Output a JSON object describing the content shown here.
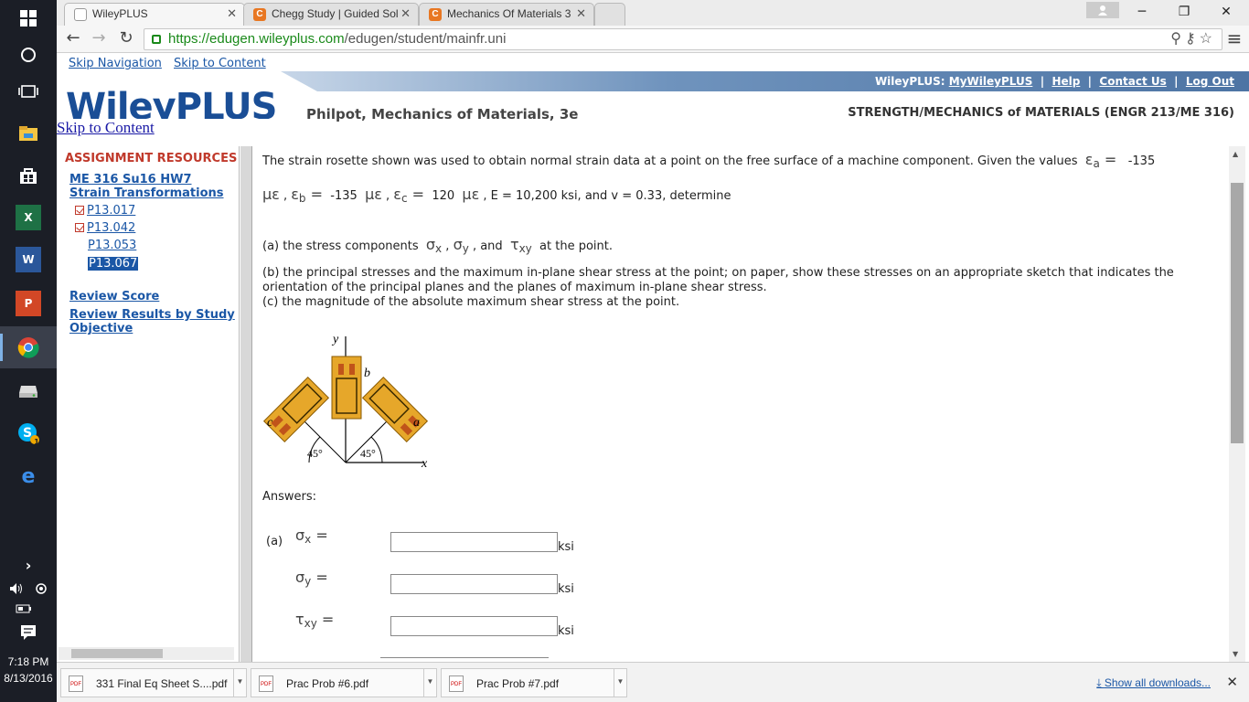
{
  "taskbar": {
    "time": "7:18 PM",
    "date": "8/13/2016",
    "icons": [
      "windows-start",
      "cortana",
      "task-view",
      "file-explorer",
      "store",
      "excel",
      "word",
      "powerpoint",
      "chrome",
      "drive",
      "skype",
      "edge"
    ],
    "skype_badge": "1"
  },
  "browser": {
    "tabs": [
      {
        "title": "WileyPLUS",
        "active": true
      },
      {
        "title": "Chegg Study | Guided Sol",
        "active": false
      },
      {
        "title": "Mechanics Of Materials 3",
        "active": false
      }
    ],
    "url_secure": "https://edugen.wileyplus.com",
    "url_path": "/edugen/student/mainfr.uni"
  },
  "header": {
    "skip_navigation": "Skip Navigation",
    "skip_content": "Skip to Content",
    "wileyplus_label": "WileyPLUS:",
    "links": [
      "MyWileyPLUS",
      "Help",
      "Contact Us",
      "Log Out"
    ],
    "logo": "WileyPLUS",
    "skip_content_2": "Skip to Content",
    "book_title": "Philpot, Mechanics of Materials, 3e",
    "course_title": "STRENGTH/MECHANICS of MATERIALS (ENGR 213/ME 316)"
  },
  "sidebar": {
    "section_title": "ASSIGNMENT RESOURCES",
    "assignment_line1": "ME 316 Su16 HW7",
    "assignment_line2": "Strain Transformations",
    "problems": [
      {
        "label": "P13.017",
        "checked": true,
        "selected": false
      },
      {
        "label": "P13.042",
        "checked": true,
        "selected": false
      },
      {
        "label": "P13.053",
        "checked": false,
        "selected": false
      },
      {
        "label": "P13.067",
        "checked": false,
        "selected": true
      }
    ],
    "review_score": "Review Score",
    "review_results_1": "Review Results by Study",
    "review_results_2": "Objective"
  },
  "problem": {
    "intro": "The strain rosette shown was used to obtain normal strain data at a point on the free surface of a machine component. Given the values",
    "eps_a": "-135",
    "eps_b": "-135",
    "eps_c": "120",
    "unit_strain": "με",
    "E_text": ", E = 10,200 ksi, and",
    "nu_text": "v = 0.33, determine",
    "part_a_prefix": "(a) the stress components",
    "part_a_suffix": "at the point.",
    "part_b": "(b) the principal stresses and the maximum in-plane shear stress at the point; on paper, show these stresses on an appropriate sketch that indicates the orientation of the principal planes and the planes of maximum in-plane shear stress.",
    "part_c": "(c) the magnitude of the absolute maximum shear stress at the point.",
    "figure": {
      "axis_y": "y",
      "axis_x": "x",
      "gauge_a": "a",
      "gauge_b": "b",
      "gauge_c": "c",
      "angle_left": "45°",
      "angle_right": "45°"
    },
    "answers_label": "Answers:",
    "answers": [
      {
        "part": "(a)",
        "symbol": "σ",
        "sub": "x",
        "unit": "ksi",
        "value": ""
      },
      {
        "part": "",
        "symbol": "σ",
        "sub": "y",
        "unit": "ksi",
        "value": ""
      },
      {
        "part": "",
        "symbol": "τ",
        "sub": "xy",
        "unit": "ksi",
        "value": ""
      }
    ]
  },
  "downloads": {
    "items": [
      "331 Final Eq Sheet S....pdf",
      "Prac Prob #6.pdf",
      "Prac Prob #7.pdf"
    ],
    "show_all": "Show all downloads..."
  }
}
